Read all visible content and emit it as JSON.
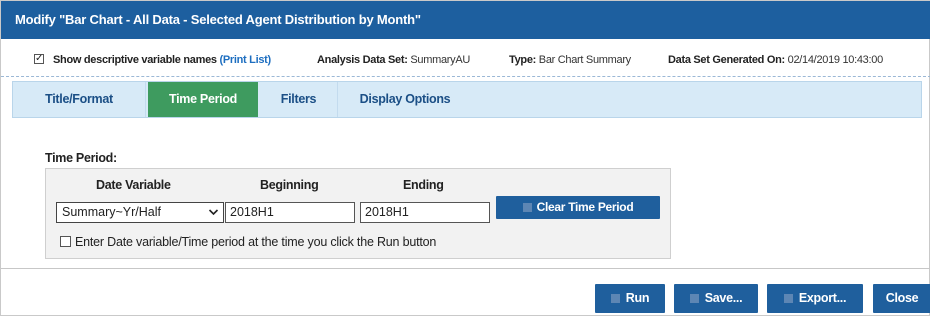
{
  "dialog": {
    "title": "Modify \"Bar Chart - All Data - Selected Agent Distribution by Month\""
  },
  "info": {
    "show_names_label": "Show descriptive variable names",
    "print_list_link": "(Print List)",
    "analysis_label": "Analysis Data Set:",
    "analysis_value": "SummaryAU",
    "type_label": "Type:",
    "type_value": "Bar Chart Summary",
    "generated_label": "Data Set Generated On:",
    "generated_value": "02/14/2019 10:43:00"
  },
  "tabs": [
    {
      "label": "Title/Format",
      "active": false
    },
    {
      "label": "Time Period",
      "active": true
    },
    {
      "label": "Filters",
      "active": false
    },
    {
      "label": "Display Options",
      "active": false
    }
  ],
  "time_period": {
    "section_title": "Time Period:",
    "date_variable_header": "Date Variable",
    "beginning_header": "Beginning",
    "ending_header": "Ending",
    "date_variable_value": "Summary~Yr/Half",
    "beginning_value": "2018H1",
    "ending_value": "2018H1",
    "clear_button": "Clear Time Period",
    "enter_at_runtime_label": "Enter Date variable/Time period at the time you click the Run button"
  },
  "footer": {
    "run": "Run",
    "save": "Save...",
    "export": "Export...",
    "close": "Close"
  },
  "colors": {
    "title_bar": "#1d5f9f",
    "active_tab": "#3e9b5f",
    "tab_strip": "#d7eaf7",
    "button": "#1f5f9d"
  }
}
